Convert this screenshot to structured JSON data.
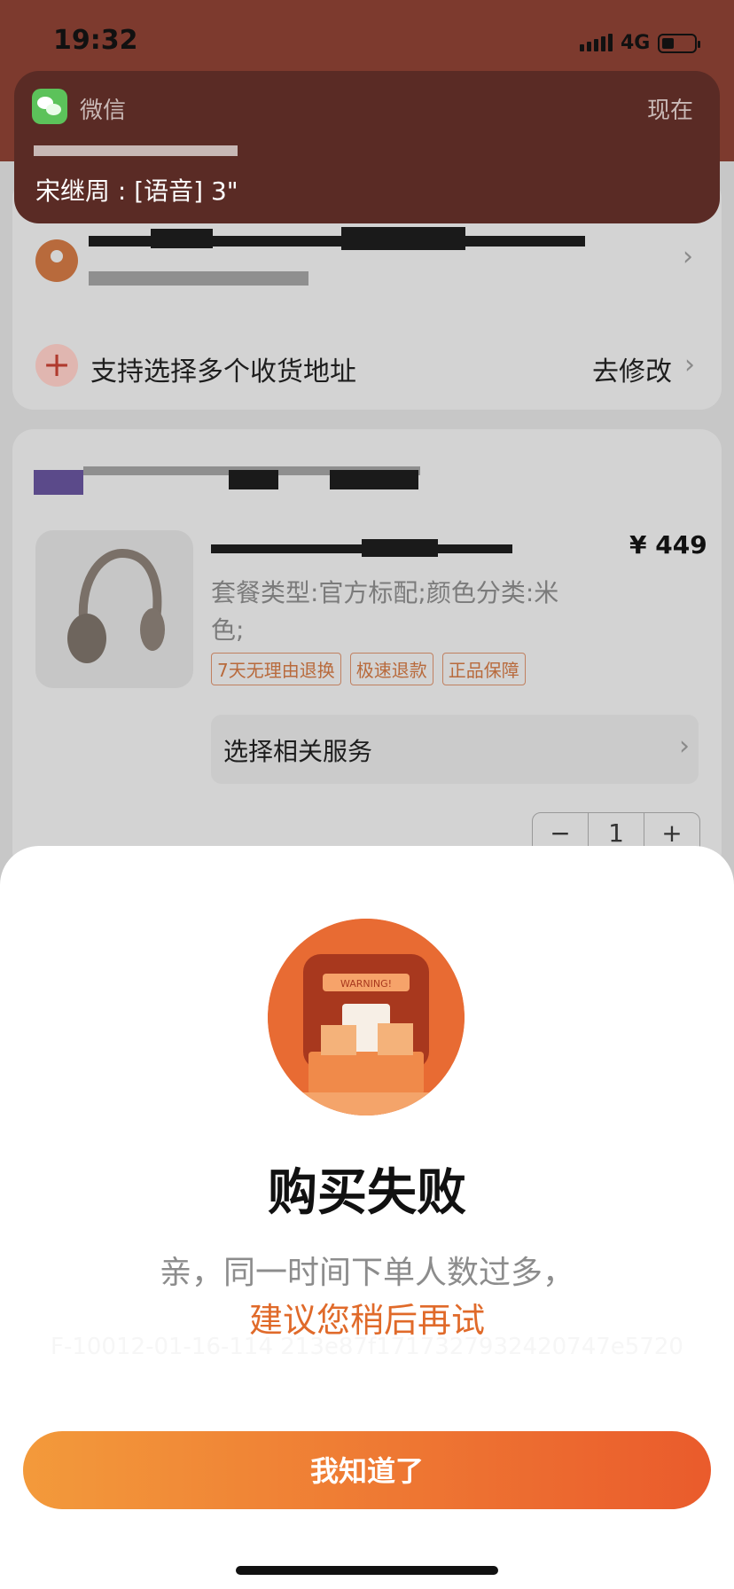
{
  "status_bar": {
    "time": "19:32",
    "network": "4G"
  },
  "notification": {
    "app": "微信",
    "time": "现在",
    "message": "宋继周 : [语音] 3\""
  },
  "address": {
    "multi_label": "支持选择多个收货地址",
    "modify_label": "去修改"
  },
  "product": {
    "price": "¥ 449",
    "spec": "套餐类型:官方标配;颜色分类:米色;",
    "tags": [
      "7天无理由退换",
      "极速退款",
      "正品保障"
    ],
    "service_label": "选择相关服务",
    "quantity": "1",
    "minus": "−",
    "plus": "+"
  },
  "dialog": {
    "title": "购买失败",
    "message_line1": "亲，同一时间下单人数过多，",
    "message_line2": "建议您稍后再试",
    "error_code": "F-10012-01-16-114 213e87f1717327932420747e5720",
    "ok_label": "我知道了"
  },
  "colors": {
    "accent": "#e06a2a",
    "button_start": "#f39a3b",
    "button_end": "#ea5b2c"
  }
}
